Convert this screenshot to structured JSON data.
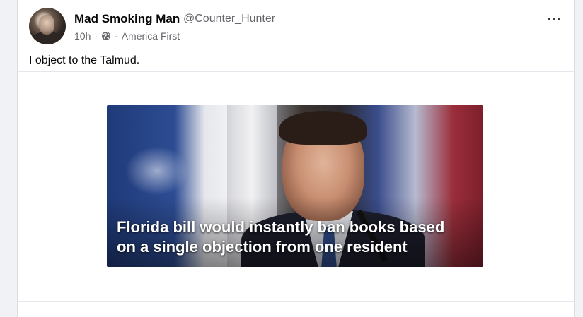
{
  "post": {
    "author_name": "Mad Smoking Man",
    "author_handle": "@Counter_Hunter",
    "time": "10h",
    "separator": "·",
    "audience_icon": "globe-icon",
    "group": "America First",
    "text": "I object to the Talmud.",
    "more_icon": "more-horizontal-icon"
  },
  "media": {
    "caption_line1": "Florida bill would instantly ban books based",
    "caption_line2": "on a single objection from one resident"
  }
}
